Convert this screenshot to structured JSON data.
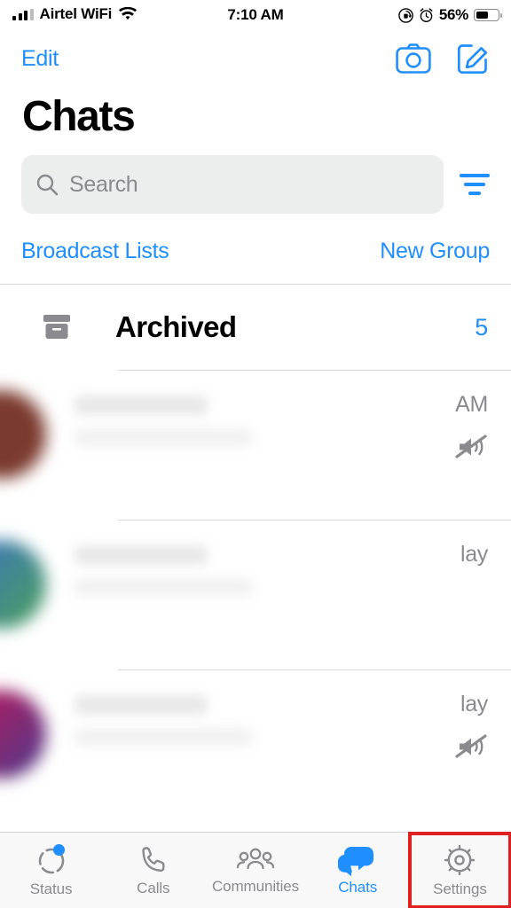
{
  "status_bar": {
    "carrier": "Airtel WiFi",
    "time": "7:10 AM",
    "battery_percent": "56%",
    "icons": [
      "cellular-bars-icon",
      "wifi-icon",
      "rotation-lock-icon",
      "alarm-clock-icon",
      "battery-icon"
    ]
  },
  "nav": {
    "edit_label": "Edit",
    "camera_icon": "camera-icon",
    "compose_icon": "compose-icon"
  },
  "header": {
    "title": "Chats"
  },
  "search": {
    "placeholder": "Search",
    "icon": "search-icon",
    "filter_icon": "filter-icon"
  },
  "links": {
    "broadcast_lists": "Broadcast Lists",
    "new_group": "New Group"
  },
  "archived": {
    "icon": "archive-box-icon",
    "label": "Archived",
    "count": "5"
  },
  "chats": [
    {
      "time": "AM",
      "muted": true
    },
    {
      "time": "lay",
      "muted": false
    },
    {
      "time": "lay",
      "muted": true
    }
  ],
  "tabs": [
    {
      "label": "Status",
      "icon": "status-ring-icon",
      "active": false,
      "badge": true
    },
    {
      "label": "Calls",
      "icon": "phone-icon",
      "active": false,
      "badge": false
    },
    {
      "label": "Communities",
      "icon": "communities-icon",
      "active": false,
      "badge": false
    },
    {
      "label": "Chats",
      "icon": "chats-bubble-icon",
      "active": true,
      "badge": false
    },
    {
      "label": "Settings",
      "icon": "gear-icon",
      "active": false,
      "badge": false,
      "highlighted": true
    }
  ],
  "colors": {
    "accent": "#1f8fff",
    "highlight_box": "#e02020",
    "muted_text": "#8a8a8f",
    "search_bg": "#eceded"
  }
}
